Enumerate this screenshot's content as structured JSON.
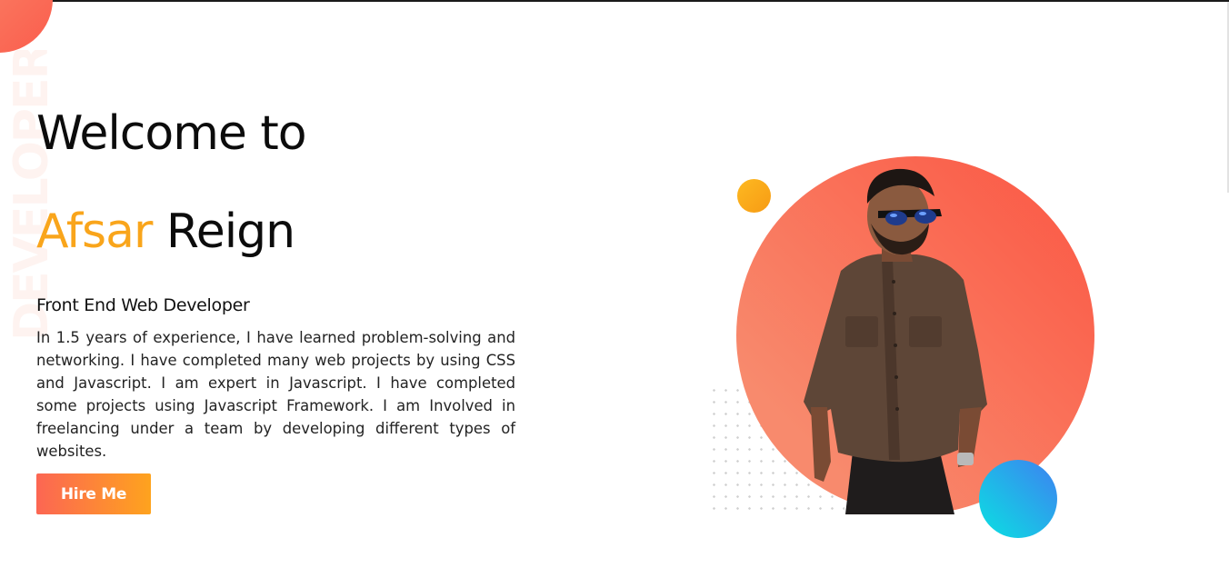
{
  "watermark": {
    "text": "DEVELOPER"
  },
  "hero": {
    "welcome": "Welcome to",
    "first_name": "Afsar",
    "last_name": "Reign",
    "role": "Front End Web Developer",
    "bio": "In 1.5 years of experience, I have learned problem-solving and networking. I have completed many web projects by using CSS and Javascript. I am expert in Javascript. I have completed some projects using Javascript Framework. I am Involved in freelancing under a team by developing different types of websites.",
    "hire_label": "Hire Me"
  },
  "colors": {
    "accent_orange": "#f9a51b",
    "coral": "#fb5d4d",
    "button_start": "#fc6653",
    "button_end": "#fea31e",
    "teal": "#0fd7e3",
    "blue": "#3b86f0"
  },
  "icons": {
    "portrait": "person-photo"
  }
}
